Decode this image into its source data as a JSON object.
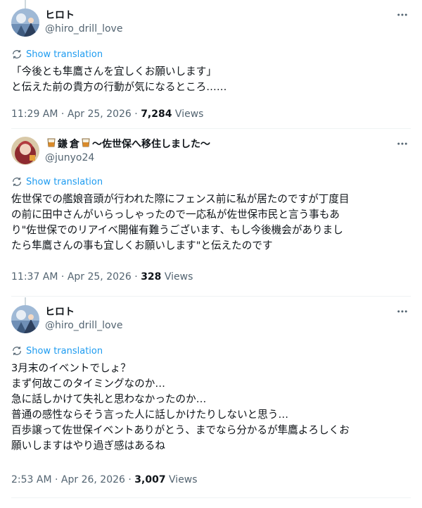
{
  "posts": [
    {
      "display_name": "ヒロト",
      "handle": "@hiro_drill_love",
      "translate_label": "Show translation",
      "lines": [
        "「今後とも隼鷹さんを宜しくお願いします」",
        "と伝えた前の貴方の行動が気になるところ……"
      ],
      "time": "11:29 AM",
      "sep1": " · ",
      "date": "Apr 25, 2026",
      "sep2": " · ",
      "views_count": "7,284",
      "views_label": " Views"
    },
    {
      "display_name_parts": [
        "鎌",
        "倉",
        "〜佐世保へ移住しました〜"
      ],
      "name_emoji": "🥃",
      "handle": "@junyo24",
      "translate_label": "Show translation",
      "lines": [
        "佐世保での艦娘音頭が行われた際にフェンス前に私が居たのですが丁度目",
        "の前に田中さんがいらっしゃったので一応私が佐世保市民と言う事もあ",
        "り\"佐世保でのリアイベ開催有難うございます、もし今後機会がありまし",
        "たら隼鷹さんの事も宜しくお願いします\"と伝えたのです"
      ],
      "time": "11:37 AM",
      "sep1": " · ",
      "date": "Apr 25, 2026",
      "sep2": " · ",
      "views_count": "328",
      "views_label": " Views"
    },
    {
      "display_name": "ヒロト",
      "handle": "@hiro_drill_love",
      "translate_label": "Show translation",
      "lines": [
        "3月末のイベントでしょ？",
        "まず何故このタイミングなのか…",
        "急に話しかけて失礼と思わなかったのか…",
        "普通の感性ならそう言った人に話しかけたりしないと思う…",
        "百歩譲って佐世保イベントありがとう、までなら分かるが隼鷹よろしくお",
        "願いしますはやり過ぎ感はあるね"
      ],
      "time": "2:53 AM",
      "sep1": " · ",
      "date": "Apr 26, 2026",
      "sep2": " · ",
      "views_count": "3,007",
      "views_label": " Views"
    }
  ],
  "icons": {
    "more": "more-horizontal-icon",
    "translate": "translate-icon",
    "emoji": "whisky-glass-emoji"
  },
  "colors": {
    "link": "#1d9bf0",
    "secondary": "#536471",
    "primary": "#0f1419",
    "thread_line": "#cfd9de"
  }
}
